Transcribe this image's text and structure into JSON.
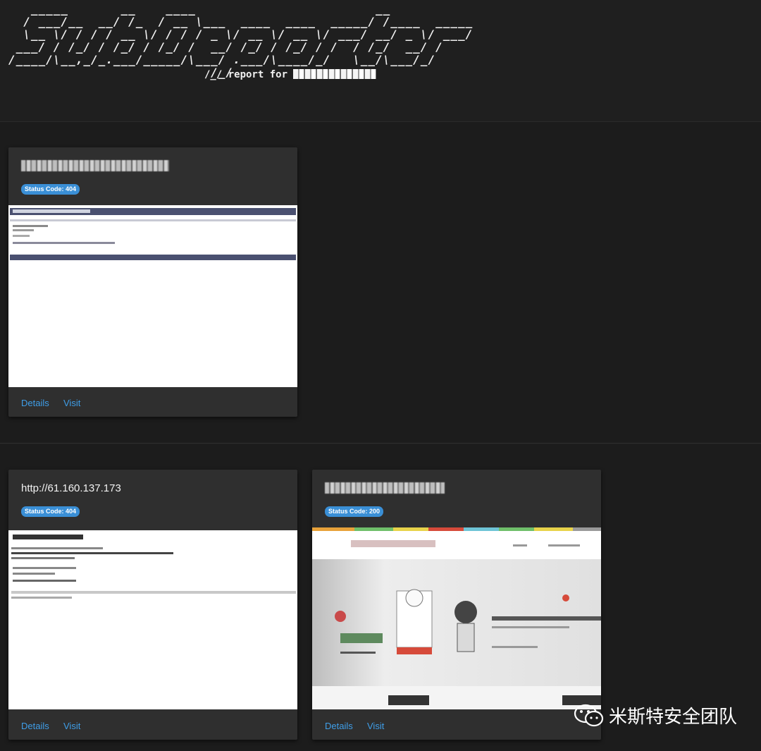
{
  "header": {
    "banner_art": "   _____       __    ____                        __           \n  / ___/__  __/ /_  / __ \\___  ____  ____  _____/ /____  _____\n  \\__ \\/ / / / __ \\/ / / / _ \\/ __ \\/ __ \\/ ___/ __/ _ \\/ ___/\n ___/ / /_/ / /_/ / /_/ /  __/ /_/ / /_/ / /  / /_/  __/ /    \n/____/\\__,_/_.___/_____/\\___/ .___/\\____/_/   \\__/\\___/_/     \n                           /_/                                ",
    "report_prefix": "/_/ report for "
  },
  "cards": [
    {
      "title": "",
      "status": "Status Code: 404",
      "details_label": "Details",
      "visit_label": "Visit"
    },
    {
      "title": "http://61.160.137.173",
      "status": "Status Code: 404",
      "details_label": "Details",
      "visit_label": "Visit"
    },
    {
      "title": "",
      "status": "Status Code: 200",
      "details_label": "Details",
      "visit_label": "Visit"
    }
  ],
  "watermark": {
    "text": "米斯特安全团队",
    "icon": "wechat-icon"
  },
  "colors": {
    "background": "#1e1e1e",
    "card": "#2f2f2f",
    "badge": "#3a8fd6",
    "link": "#3f9ee8"
  }
}
